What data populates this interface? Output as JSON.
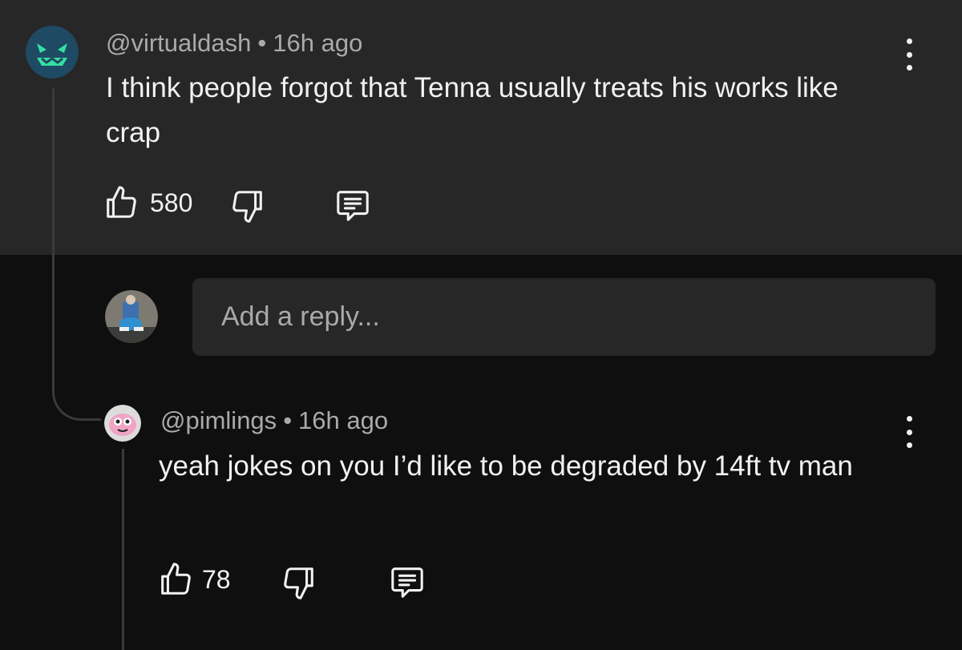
{
  "comment": {
    "author": "@virtualdash",
    "separator": "•",
    "time": "16h ago",
    "text": "I think people forgot that Tenna usually treats his works like crap",
    "likes": "580",
    "avatar_icon": "green-grinning-face-icon"
  },
  "reply_input": {
    "placeholder": "Add a reply..."
  },
  "reply": {
    "author": "@pimlings",
    "separator": "•",
    "time": "16h ago",
    "text": "yeah jokes on you I’d like to be degraded by 14ft tv man",
    "likes": "78",
    "avatar_icon": "pink-blob-face-icon"
  },
  "colors": {
    "background": "#0f0f0f",
    "highlight": "#272727",
    "muted_text": "#aaaaaa",
    "text": "#f1f1f1"
  }
}
